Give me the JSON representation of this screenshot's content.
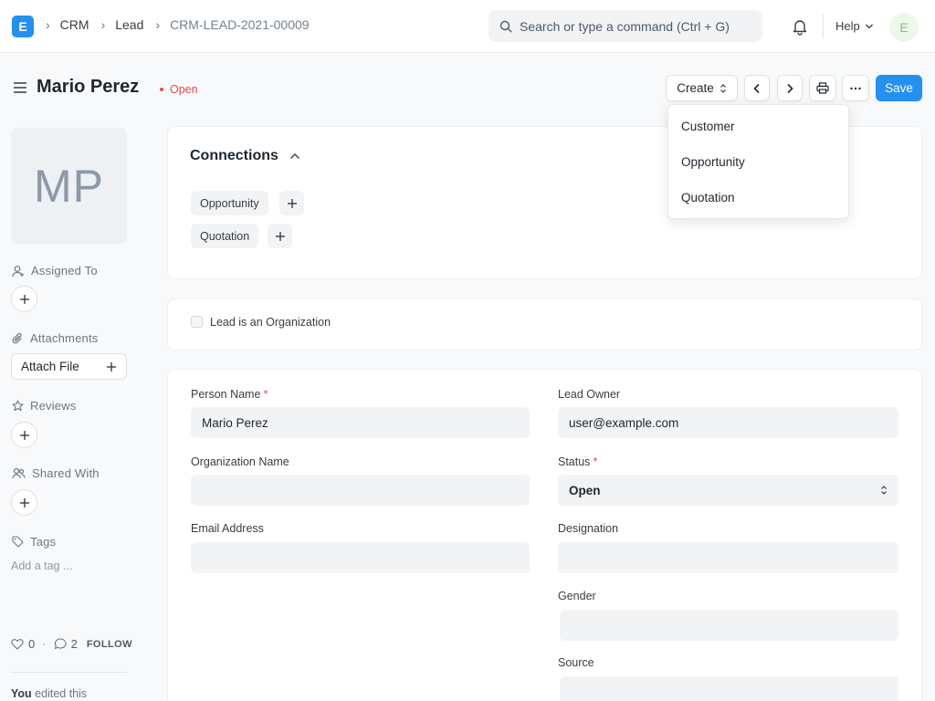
{
  "app": {
    "logo_letter": "E"
  },
  "breadcrumbs": [
    "CRM",
    "Lead",
    "CRM-LEAD-2021-00009"
  ],
  "search": {
    "placeholder": "Search or type a command (Ctrl + G)"
  },
  "navbar": {
    "help_label": "Help",
    "user_initial": "E"
  },
  "page": {
    "title": "Mario Perez",
    "status": "Open"
  },
  "toolbar": {
    "create_label": "Create",
    "save_label": "Save"
  },
  "create_menu": [
    "Customer",
    "Opportunity",
    "Quotation"
  ],
  "sidebar": {
    "avatar_initials": "MP",
    "assigned_to_label": "Assigned To",
    "attachments_label": "Attachments",
    "attach_file_label": "Attach File",
    "reviews_label": "Reviews",
    "shared_with_label": "Shared With",
    "tags_label": "Tags",
    "add_tag_placeholder": "Add a tag ...",
    "likes_count": "0",
    "comments_count": "2",
    "follow_label": "FOLLOW",
    "activity_user": "You",
    "activity_text": "edited this"
  },
  "connections": {
    "title": "Connections",
    "items": [
      "Opportunity",
      "Quotation"
    ]
  },
  "org_checkbox_label": "Lead is an Organization",
  "form": {
    "person_name": {
      "label": "Person Name",
      "value": "Mario Perez"
    },
    "organization_name": {
      "label": "Organization Name",
      "value": ""
    },
    "email_address": {
      "label": "Email Address",
      "value": ""
    },
    "lead_owner": {
      "label": "Lead Owner",
      "value": "user@example.com"
    },
    "status": {
      "label": "Status",
      "value": "Open"
    },
    "designation": {
      "label": "Designation",
      "value": ""
    },
    "gender": {
      "label": "Gender",
      "value": ""
    },
    "source": {
      "label": "Source",
      "value": ""
    }
  },
  "colors": {
    "primary": "#2490ef",
    "status_open": "#e24c4c"
  }
}
